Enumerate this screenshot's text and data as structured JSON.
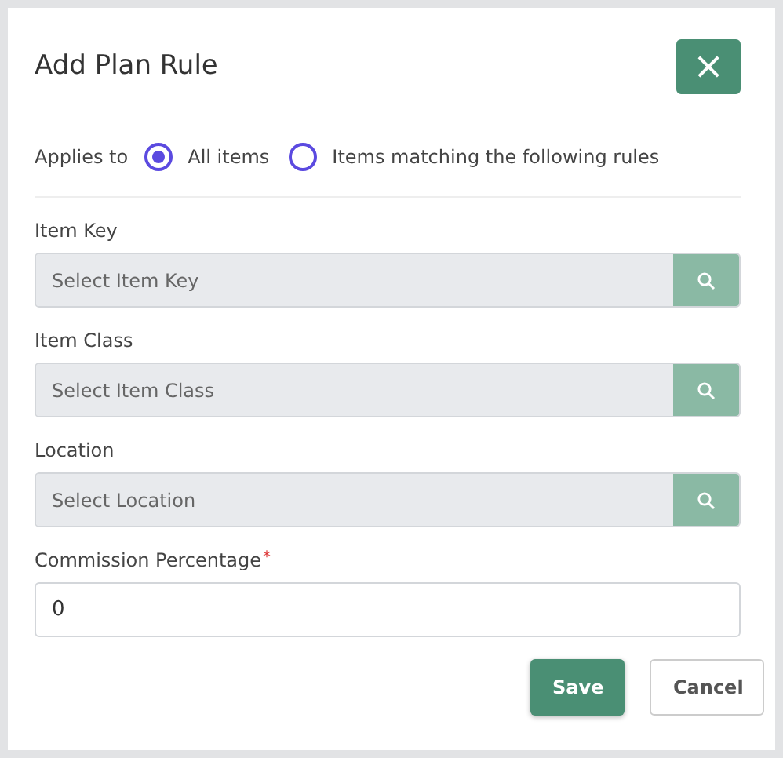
{
  "dialog": {
    "title": "Add Plan Rule",
    "close_button": "×"
  },
  "applies_to": {
    "label": "Applies to",
    "options": [
      {
        "label": "All items",
        "selected": true
      },
      {
        "label": "Items matching the following rules",
        "selected": false
      }
    ]
  },
  "fields": [
    {
      "kind": "lookup",
      "label": "Item Key",
      "placeholder": "Select Item Key"
    },
    {
      "kind": "lookup",
      "label": "Item Class",
      "placeholder": "Select Item Class"
    },
    {
      "kind": "lookup",
      "label": "Location",
      "placeholder": "Select Location"
    },
    {
      "kind": "text",
      "label": "Commission Percentage",
      "required_mark": "*",
      "value": "0"
    }
  ],
  "buttons": [
    {
      "kind": "primary",
      "label": "Save"
    },
    {
      "kind": "secondary",
      "label": "Cancel"
    }
  ]
}
